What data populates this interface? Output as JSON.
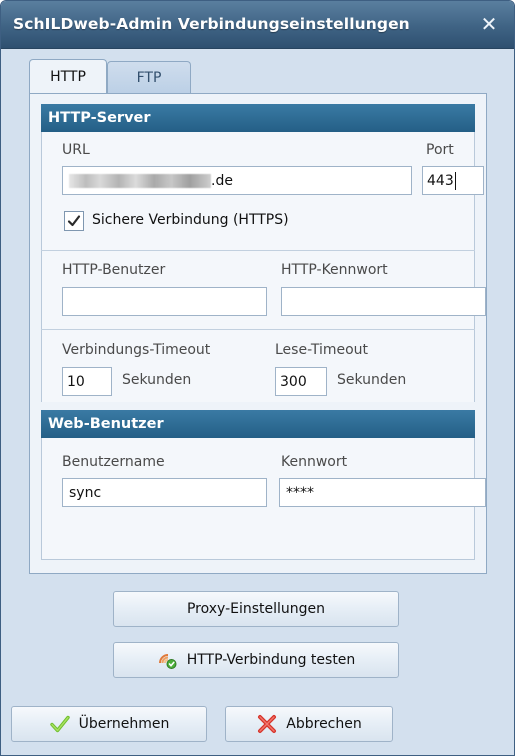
{
  "window": {
    "title": "SchILDweb-Admin Verbindungseinstellungen",
    "close_symbol": "✕"
  },
  "tabs": [
    {
      "label": "HTTP",
      "active": true
    },
    {
      "label": "FTP",
      "active": false
    }
  ],
  "http_server": {
    "header": "HTTP-Server",
    "url_label": "URL",
    "url_suffix": ".de",
    "port_label": "Port",
    "port_value": "443",
    "https_checkbox_label": "Sichere Verbindung (HTTPS)",
    "https_checked": true,
    "user_label": "HTTP-Benutzer",
    "user_value": "",
    "password_label": "HTTP-Kennwort",
    "password_value": "",
    "connect_timeout_label": "Verbindungs-Timeout",
    "connect_timeout_value": "10",
    "connect_timeout_unit": "Sekunden",
    "read_timeout_label": "Lese-Timeout",
    "read_timeout_value": "300",
    "read_timeout_unit": "Sekunden"
  },
  "web_user": {
    "header": "Web-Benutzer",
    "username_label": "Benutzername",
    "username_value": "sync",
    "password_label": "Kennwort",
    "password_value": "****"
  },
  "buttons": {
    "proxy": "Proxy-Einstellungen",
    "test_connection": "HTTP-Verbindung testen",
    "apply": "Übernehmen",
    "cancel": "Abbrechen"
  },
  "icons": {
    "test_connection": "network-test-icon",
    "apply": "green-checkmark-icon",
    "cancel": "red-x-icon"
  },
  "colors": {
    "titlebar": "#3f6384",
    "section_header": "#2c6a93",
    "window_bg": "#d3e0ee",
    "panel_bg": "#eef3f9"
  }
}
